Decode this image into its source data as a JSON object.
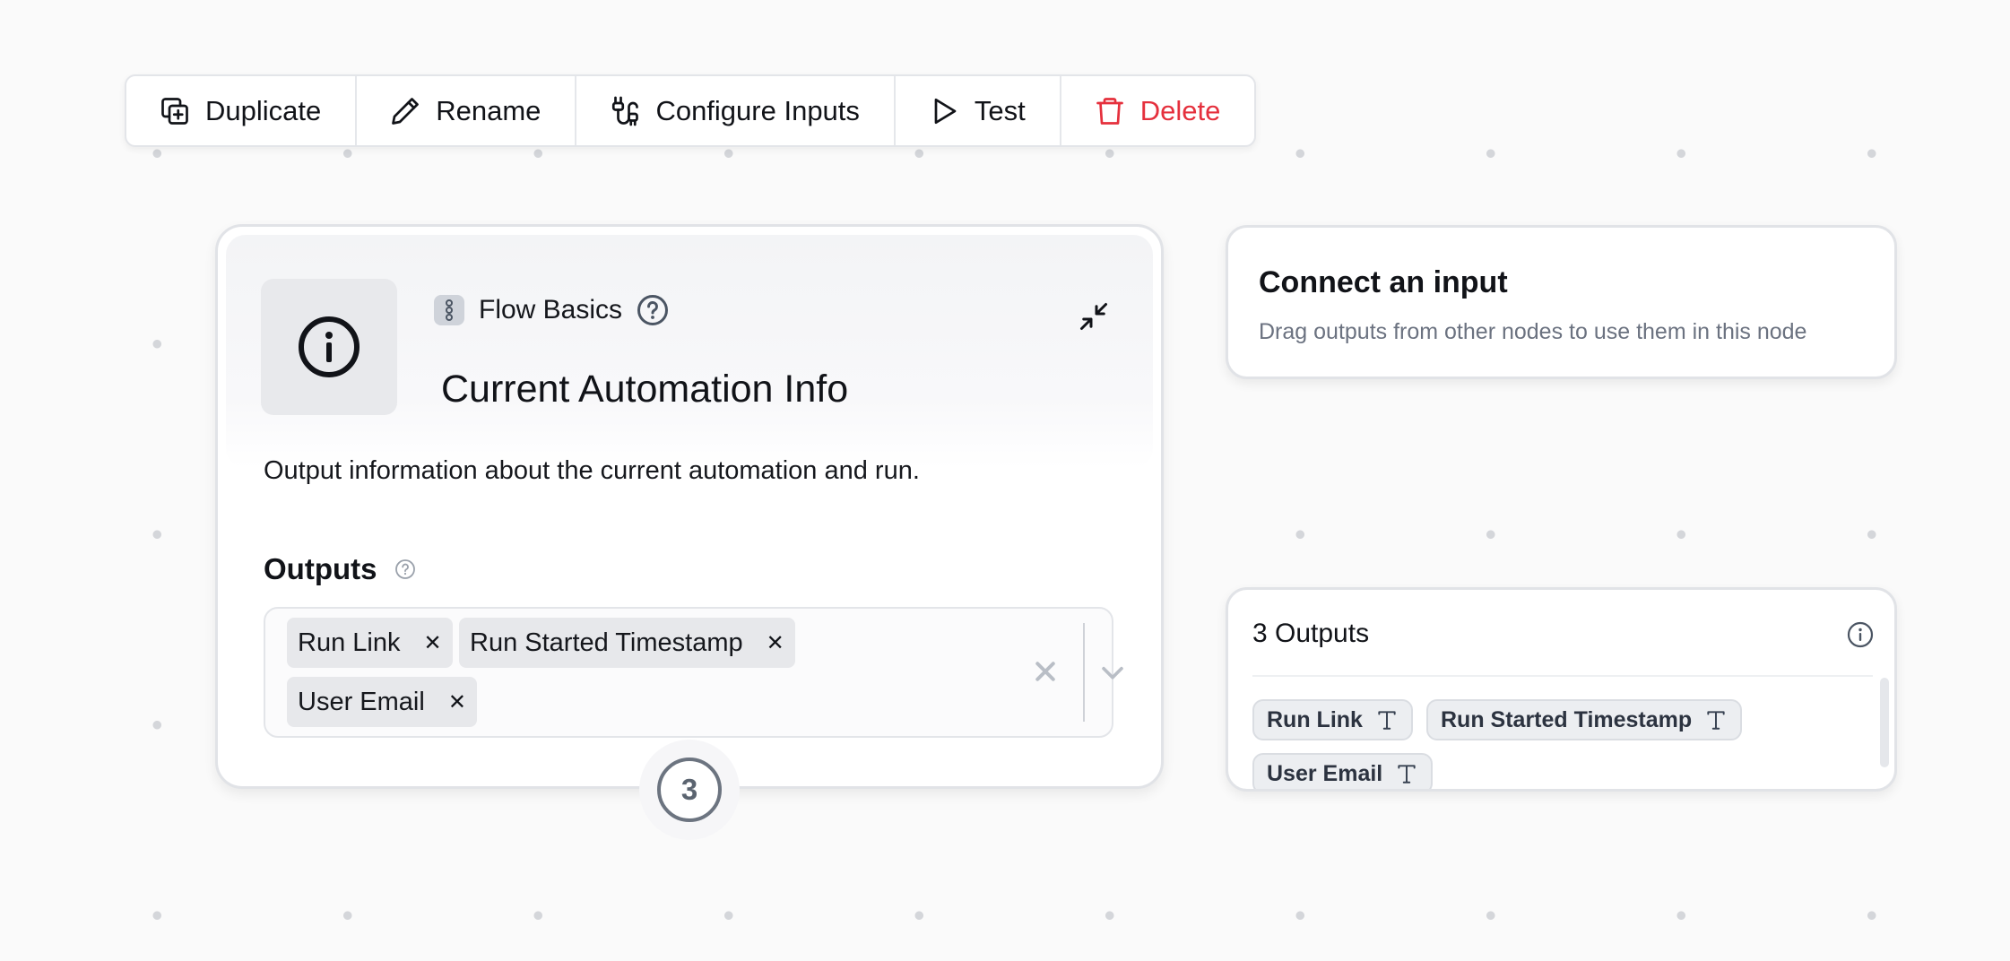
{
  "toolbar": {
    "duplicate": "Duplicate",
    "rename": "Rename",
    "configure_inputs": "Configure Inputs",
    "test": "Test",
    "delete": "Delete"
  },
  "node": {
    "category": "Flow Basics",
    "title": "Current Automation Info",
    "description": "Output information about the current automation and run.",
    "outputs_label": "Outputs",
    "selected_outputs": [
      "Run Link",
      "Run Started Timestamp",
      "User Email"
    ],
    "output_count": "3"
  },
  "input_panel": {
    "title": "Connect an input",
    "subtitle": "Drag outputs from other nodes to use them in this node"
  },
  "outputs_panel": {
    "title": "3 Outputs",
    "items": [
      "Run Link",
      "Run Started Timestamp",
      "User Email"
    ]
  },
  "colors": {
    "danger": "#e5303d",
    "canvas": "#fafafa",
    "chip": "#e7e8eb"
  },
  "icons": {
    "duplicate": "duplicate-icon",
    "rename": "pencil-icon",
    "configure_inputs": "plug-icon",
    "test": "play-icon",
    "delete": "trash-icon",
    "node": "info-icon",
    "category": "flow-icon",
    "help": "help-icon",
    "collapse": "collapse-icon",
    "type": "text-type-icon"
  }
}
